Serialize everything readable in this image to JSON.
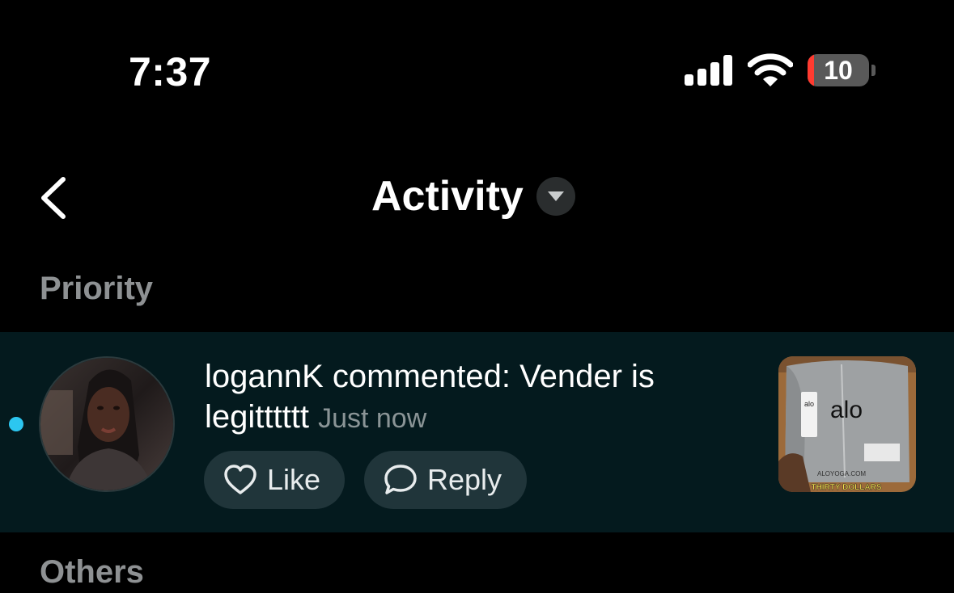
{
  "status_bar": {
    "time": "7:37",
    "battery_level": "10",
    "battery_percent": 10,
    "icons": [
      "cellular-signal-icon",
      "wifi-icon",
      "battery-icon"
    ]
  },
  "nav": {
    "back_icon": "chevron-left-icon",
    "title": "Activity",
    "dropdown_icon": "caret-down-icon"
  },
  "sections": {
    "priority": "Priority",
    "others": "Others"
  },
  "notification": {
    "unread": true,
    "username": "logannK",
    "message": "logannK commented: Vender is legitttttt",
    "time": "Just now",
    "like_label": "Like",
    "reply_label": "Reply",
    "thumbnail": {
      "brand_text": "alo",
      "tag_text": "alo",
      "site_text": "ALOYOGA.COM",
      "caption": "THIRTY DOLLARS"
    }
  },
  "colors": {
    "background": "#000000",
    "row_background": "#041a1e",
    "unread_dot": "#2cc6f0",
    "pill_background": "#20353a",
    "secondary_text": "#8e9193",
    "battery_low": "#ff3b30"
  }
}
